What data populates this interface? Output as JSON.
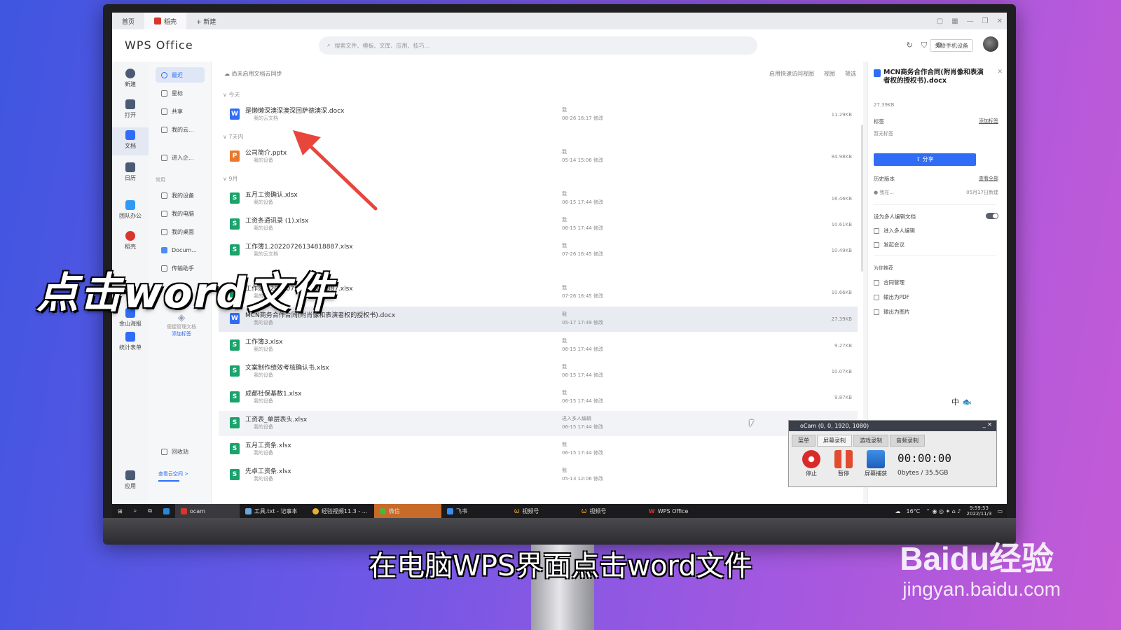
{
  "titlebar": {
    "tabs": [
      {
        "label": "首页"
      },
      {
        "label": "稻壳"
      },
      {
        "label": "+ 新建"
      }
    ]
  },
  "header": {
    "logo": "WPS Office",
    "search_placeholder": "搜索文件、模板、文库、应用、技巧...",
    "phone_label": "关联手机设备"
  },
  "rail": [
    {
      "label": "新建"
    },
    {
      "label": "打开"
    },
    {
      "label": "文档"
    },
    {
      "label": "日历"
    },
    {
      "label": "团队办公"
    },
    {
      "label": "稻壳"
    },
    {
      "label": "金山海报"
    },
    {
      "label": "统计表单"
    },
    {
      "label": "应用"
    }
  ],
  "nav": {
    "items": [
      {
        "label": "最近"
      },
      {
        "label": "星标"
      },
      {
        "label": "共享"
      },
      {
        "label": "我的云..."
      },
      {
        "label": "进入企..."
      }
    ],
    "section_label": "常用",
    "common": [
      {
        "label": "我的设备"
      },
      {
        "label": "我的电脑"
      },
      {
        "label": "我的桌面"
      },
      {
        "label": "Docum..."
      },
      {
        "label": "传输助手"
      }
    ],
    "tag_hint": "便捷管理文档",
    "tag_link": "添加标签",
    "recycle": "回收站",
    "cloud_space": "查看云空间 >"
  },
  "files": {
    "sync_text": "尚未启用文档云同步",
    "actions": [
      "启用快速访问视图",
      "视图",
      "筛选"
    ],
    "groups": [
      "今天",
      "7天内",
      "9月"
    ],
    "rows": [
      {
        "name": "是懒懒深澳深澳深回萨德澳深.docx",
        "loc": "我的云文档",
        "owner": "我",
        "date": "08-26 16:17 修改",
        "size": "11.29KB",
        "type": "W"
      },
      {
        "name": "公司简介.pptx",
        "loc": "我的设备",
        "owner": "我",
        "date": "05-14 15:06 修改",
        "size": "84.98KB",
        "type": "P"
      },
      {
        "name": "五月工资确认.xlsx",
        "loc": "我的设备",
        "owner": "我",
        "date": "06-15 17:44 修改",
        "size": "16.46KB",
        "type": "S"
      },
      {
        "name": "工资条通讯录 (1).xlsx",
        "loc": "我的设备",
        "owner": "我",
        "date": "06-15 17:44 修改",
        "size": "10.61KB",
        "type": "S"
      },
      {
        "name": "工作簿1.20220726134818887.xlsx",
        "loc": "我的云文档",
        "owner": "我",
        "date": "07-26 16:45 修改",
        "size": "10.49KB",
        "type": "S"
      },
      {
        "name": "工作簿1.20220726134818887.xlsx",
        "loc": "我的设备",
        "owner": "我",
        "date": "07-26 16:45 修改",
        "size": "10.66KB",
        "type": "S"
      },
      {
        "name": "MCN商务合作合同(附肖像和表演者权的授权书).docx",
        "loc": "我的设备",
        "owner": "我",
        "date": "05-17 17:49 修改",
        "size": "27.39KB",
        "type": "W"
      },
      {
        "name": "工作簿3.xlsx",
        "loc": "我的设备",
        "owner": "我",
        "date": "06-15 17:44 修改",
        "size": "9.27KB",
        "type": "S"
      },
      {
        "name": "文案制作绩效考核确认书.xlsx",
        "loc": "我的设备",
        "owner": "我",
        "date": "06-15 17:44 修改",
        "size": "10.07KB",
        "type": "S"
      },
      {
        "name": "成都社保基数1.xlsx",
        "loc": "我的设备",
        "owner": "我",
        "date": "06-15 17:44 修改",
        "size": "9.87KB",
        "type": "S"
      },
      {
        "name": "工资表_单层表头.xlsx",
        "loc": "我的设备",
        "owner": "进入多人编辑",
        "date": "06-15 17:44 修改",
        "size": "",
        "type": "S"
      },
      {
        "name": "五月工资条.xlsx",
        "loc": "我的设备",
        "owner": "我",
        "date": "06-15 17:44 修改",
        "size": "",
        "type": "S"
      },
      {
        "name": "先卓工资条.xlsx",
        "loc": "我的设备",
        "owner": "我",
        "date": "05-13 12:06 修改",
        "size": "",
        "type": "S"
      }
    ]
  },
  "rpanel": {
    "title": "MCN商务合作合同(附肖像和表演者权的授权书).docx",
    "size": "27.39KB",
    "tag_label": "标签",
    "tag_add": "添加标签",
    "tag_none": "暂无标签",
    "share": "分享",
    "history_label": "历史版本",
    "history_all": "查看全部",
    "history_user": "我在...",
    "history_date": "05月17日新建",
    "multi_edit": "设为多人编辑文档",
    "enter_multi": "进入多人编辑",
    "meeting": "发起会议",
    "recommend": "为你推荐",
    "rec_items": [
      "合同管理",
      "输出为PDF",
      "输出为图片"
    ]
  },
  "taskbar": {
    "apps": [
      "ocam",
      "工具.txt - 记事本",
      "经验视频11.3 - ...",
      "微信",
      "飞书",
      "视频号",
      "视频号",
      "WPS Office"
    ],
    "weather": "16°C",
    "time": "9:59:53",
    "date": "2022/11/3"
  },
  "ocam": {
    "title": "oCam (0, 0, 1920, 1080)",
    "tabs": [
      "菜单",
      "屏幕录制",
      "游戏录制",
      "音频录制"
    ],
    "stop": "停止",
    "pause": "暂停",
    "capture": "屏幕捕获",
    "time": "00:00:00",
    "size": "0bytes / 35.5GB"
  },
  "ime_text": "中",
  "overlay": {
    "caption": "点击word文件",
    "subtitle": "在电脑WPS界面点击word文件",
    "watermark": "Baidu经验",
    "watermark_url": "jingyan.baidu.com"
  },
  "colors": {
    "accent": "#2f6df6",
    "word": "#2f6df6",
    "sheet": "#1aa36b",
    "ppt": "#e8792c",
    "arrow": "#e8453c"
  }
}
